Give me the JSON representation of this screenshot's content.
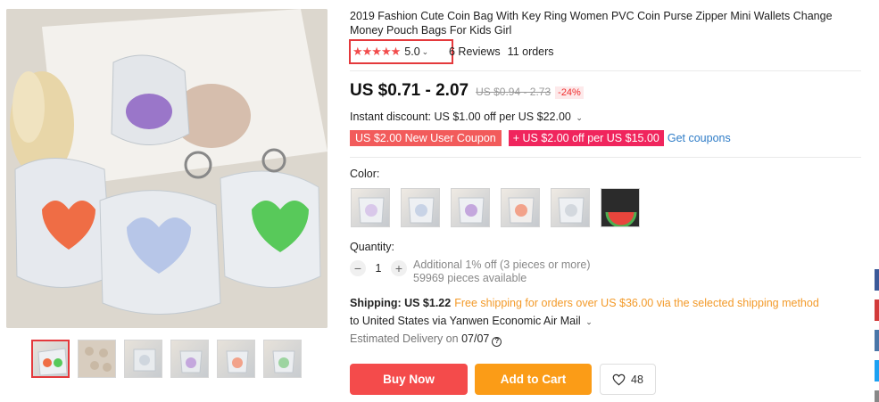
{
  "product": {
    "title": "2019 Fashion Cute Coin Bag With Key Ring Women PVC Coin Purse Zipper Mini Wallets Change Money Pouch Bags For Kids Girl",
    "rating": {
      "stars": "★★★★★",
      "value": "5.0",
      "chevron": "⌄",
      "reviews": "6 Reviews",
      "orders": "11 orders"
    },
    "price": {
      "current": "US $0.71 - 2.07",
      "original": "US $0.94 - 2.73",
      "discount": "-24%"
    },
    "instant_discount": "Instant discount: US $1.00 off per US $22.00",
    "coupons": {
      "new_user": "US $2.00 New User Coupon",
      "extra": "+ US $2.00 off per US $15.00",
      "get_link": "Get coupons"
    },
    "color": {
      "label": "Color:"
    },
    "quantity": {
      "label": "Quantity:",
      "minus": "−",
      "value": "1",
      "plus": "+",
      "additional": "Additional 1% off (3 pieces or more)",
      "available": "59969 pieces available"
    },
    "shipping": {
      "label": "Shipping: US $1.22",
      "free": "Free shipping for orders over US $36.00 via the selected shipping method",
      "to": "to United States via Yanwen Economic Air Mail",
      "estimated_prefix": "Estimated Delivery on ",
      "estimated_date": "07/07",
      "help": "?"
    },
    "actions": {
      "buy_now": "Buy Now",
      "add_to_cart": "Add to Cart",
      "wishlist_count": "48"
    }
  },
  "colors": {
    "accent_red": "#f44b4b",
    "cart_orange": "#fb9c17",
    "link_blue": "#2e7cc7",
    "free_shipping": "#f39a29",
    "side_bars": [
      "#3b5998",
      "#d23b3b",
      "#4a76a8",
      "#1da1f2",
      "#888888"
    ]
  }
}
